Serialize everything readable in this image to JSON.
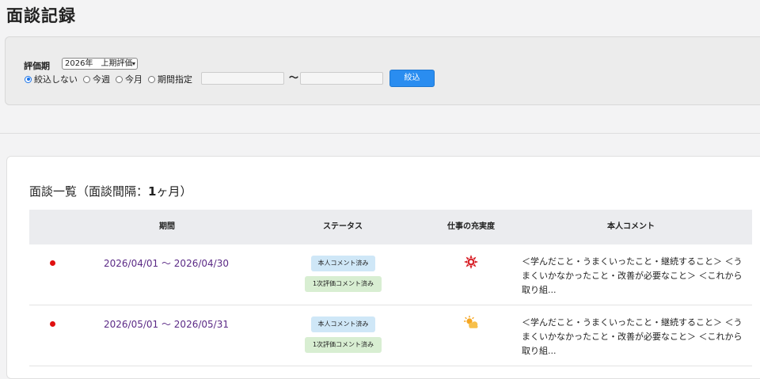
{
  "page_title": "面談記録",
  "filter": {
    "period_label": "評価期",
    "period_value": "2026年　上期評価",
    "radios": [
      {
        "label": "絞込しない",
        "checked": true
      },
      {
        "label": "今週",
        "checked": false
      },
      {
        "label": "今月",
        "checked": false
      },
      {
        "label": "期間指定",
        "checked": false
      }
    ],
    "date_from": "",
    "date_to": "",
    "tilde": "〜",
    "search_label": "絞込"
  },
  "list": {
    "title_prefix": "面談一覧（面談間隔：",
    "title_bold": "1",
    "title_suffix": "ヶ月）",
    "columns": [
      "期間",
      "ステータス",
      "仕事の充実度",
      "本人コメント"
    ],
    "rows": [
      {
        "period": "2026/04/01 〜 2026/04/30",
        "status1": "本人コメント済み",
        "status2": "1次評価コメント済み",
        "mood_icon": "sun-icon",
        "comment": "＜学んだこと・うまくいったこと・継続すること＞ ＜うまくいかなかったこと・改善が必要なこと＞ ＜これから取り組..."
      },
      {
        "period": "2026/05/01 〜 2026/05/31",
        "status1": "本人コメント済み",
        "status2": "1次評価コメント済み",
        "mood_icon": "partly-cloudy-icon",
        "comment": "＜学んだこと・うまくいったこと・継続すること＞ ＜うまくいかなかったこと・改善が必要なこと＞ ＜これから取り組..."
      }
    ]
  },
  "colors": {
    "accent": "#2a8df0",
    "link": "#5b2a86",
    "dot": "#e01010"
  }
}
